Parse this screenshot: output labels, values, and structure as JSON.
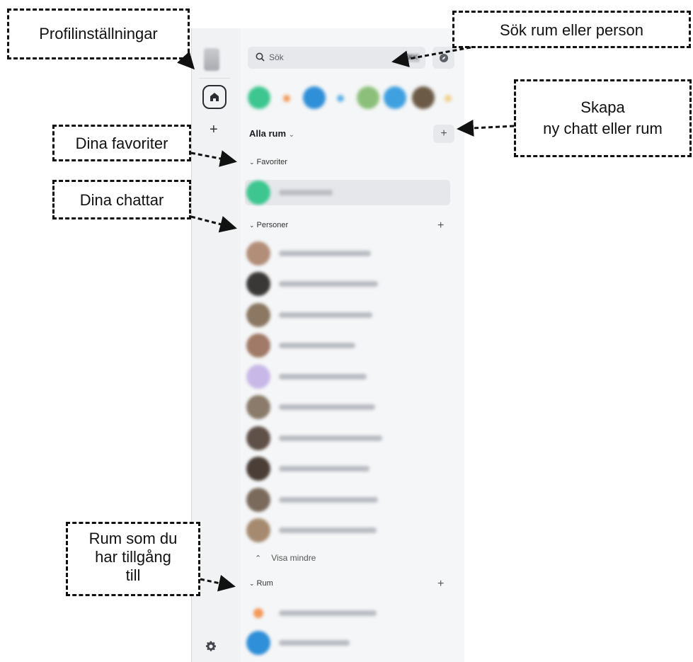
{
  "callouts": {
    "profile": "Profilinställningar",
    "search": "Sök rum eller person",
    "create_line1": "Skapa",
    "create_line2": "ny chatt eller rum",
    "favorites": "Dina favoriter",
    "chats": "Dina chattar",
    "rooms_line1": "Rum som du",
    "rooms_line2": "har tillgång",
    "rooms_line3": "till"
  },
  "search": {
    "placeholder": "Sök"
  },
  "rooms_panel": {
    "header_label": "Alla rum",
    "sections": {
      "favorites": "Favoriter",
      "people": "Personer",
      "rooms": "Rum"
    },
    "show_less": "Visa mindre"
  },
  "icons": {
    "home": "home-icon",
    "search": "search-icon",
    "explore": "compass-icon",
    "settings": "gear-icon",
    "add": "plus-icon"
  },
  "colors": {
    "accent": "#2f8fd8",
    "green": "#3dc68f"
  }
}
